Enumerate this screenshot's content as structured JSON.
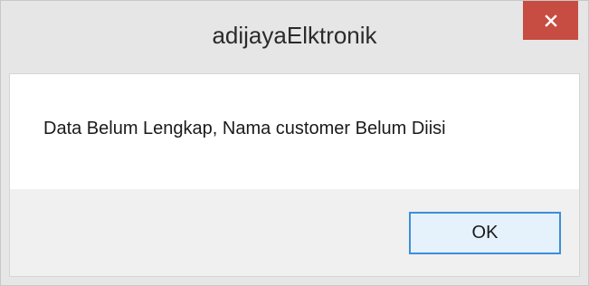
{
  "window": {
    "title": "adijayaElktronik",
    "close_icon": "close-icon"
  },
  "dialog": {
    "message": "Data Belum Lengkap, Nama customer Belum Diisi",
    "ok_label": "OK"
  },
  "colors": {
    "close_button": "#c74c42",
    "ok_border": "#3c8fd9",
    "ok_fill": "#e5f1fb",
    "frame": "#e6e6e6"
  }
}
